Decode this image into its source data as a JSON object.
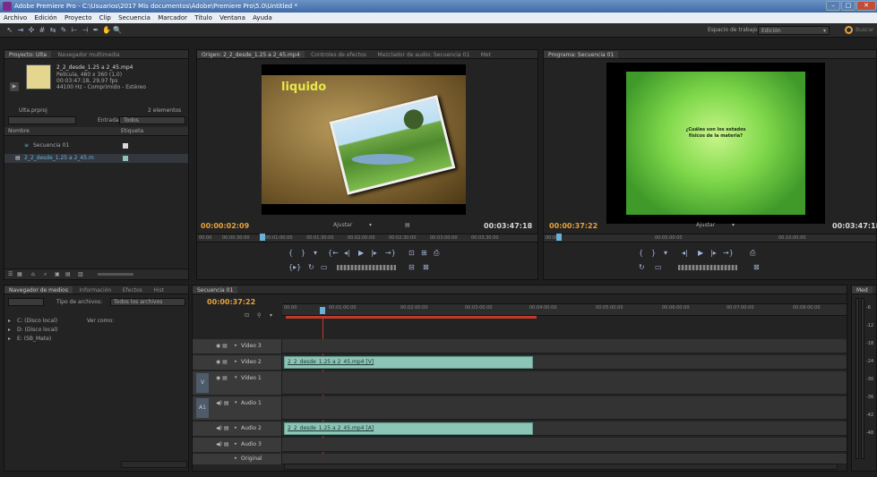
{
  "window": {
    "title": "Adobe Premiere Pro - C:\\Usuarios\\2017 Mis documentos\\Adobe\\Premiere Pro\\5.0\\Untitled *"
  },
  "menu": [
    "Archivo",
    "Edición",
    "Proyecto",
    "Clip",
    "Secuencia",
    "Marcador",
    "Título",
    "Ventana",
    "Ayuda"
  ],
  "workspace": {
    "label": "Espacio de trabajo:",
    "value": "Edición",
    "search_placeholder": "Buscar"
  },
  "project": {
    "tabs": [
      "Proyecto: Ulta",
      "Navegador multimedia"
    ],
    "clip_name": "2_2_desde_1.25 a 2_45.mp4",
    "clip_meta": [
      "Película, 480 x 360 (1,0)",
      "00:03:47:18, 29,97 fps",
      "44100 Hz - Comprimido - Estéreo"
    ],
    "project_file": "Ulta.prproj",
    "item_count": "2 elementos",
    "in_label": "Entrada:",
    "in_value": "Todos",
    "col_name": "Nombre",
    "col_label": "Etiqueta",
    "items": [
      "Secuencia 01",
      "2_2_desde_1.25 a 2_45.m"
    ]
  },
  "media_browser": {
    "tabs": [
      "Navegador de medios",
      "Información",
      "Efectos",
      "Hist"
    ],
    "files_type_label": "Tipo de archivos:",
    "files_type_value": "Todos los archivos",
    "view_as": "Ver como:",
    "drives": [
      "C: (Disco local)",
      "D: (Disco local)",
      "E: (SB_Mate)"
    ]
  },
  "source": {
    "tabs": [
      "Origen: 2_2_desde_1.25 a 2_45.mp4",
      "Controles de efectos",
      "Mezclador de audio: Secuencia 01",
      "Met"
    ],
    "overlay_word": "liquido",
    "tc_current": "00:00:02:09",
    "tc_duration": "00:03:47:18",
    "fit": "Ajustar",
    "ruler": [
      "00:00",
      "00:00:30:00",
      "00:01:00:00",
      "00:01:30:00",
      "00:02:00:00",
      "00:02:30:00",
      "00:03:00:00",
      "00:03:30:00"
    ]
  },
  "program": {
    "tabs": [
      "Programa: Secuencia 01"
    ],
    "question": "¿Cuáles son los estados físicos de la materia?",
    "tc_current": "00:00:37:22",
    "tc_duration": "00:03:47:18",
    "fit": "Ajustar",
    "ruler": [
      "00:00",
      "00:05:00:00",
      "00:10:00:00"
    ]
  },
  "timeline": {
    "tab": "Secuencia 01",
    "tc": "00:00:37:22",
    "ruler": [
      "00:00",
      "00:01:00:00",
      "00:02:00:00",
      "00:03:00:00",
      "00:04:00:00",
      "00:05:00:00",
      "00:06:00:00",
      "00:07:00:00",
      "00:08:00:00"
    ],
    "tracks": [
      {
        "name": "Vídeo 3",
        "clip": ""
      },
      {
        "name": "Vídeo 2",
        "clip": "2_2_desde_1.25 a 2_45.mp4 [V]"
      },
      {
        "name": "Vídeo 1",
        "clip": ""
      },
      {
        "name": "Audio 1",
        "clip": ""
      },
      {
        "name": "Audio 2",
        "clip": "2_2_desde_1.25 a 2_45.mp4 [A]"
      },
      {
        "name": "Audio 3",
        "clip": ""
      },
      {
        "name": "Original",
        "clip": ""
      }
    ],
    "v_target": "V",
    "a_target": "A1"
  },
  "audio_meter": {
    "tab": "Med",
    "scale": [
      "-6",
      "-12",
      "-18",
      "-24",
      "-30",
      "-36",
      "-42",
      "-48"
    ]
  },
  "colors": {
    "timecode": "#e8a23a",
    "clip": "#8cc4b6",
    "playhead": "#c0392b",
    "program_bg": "#6fd36b"
  }
}
